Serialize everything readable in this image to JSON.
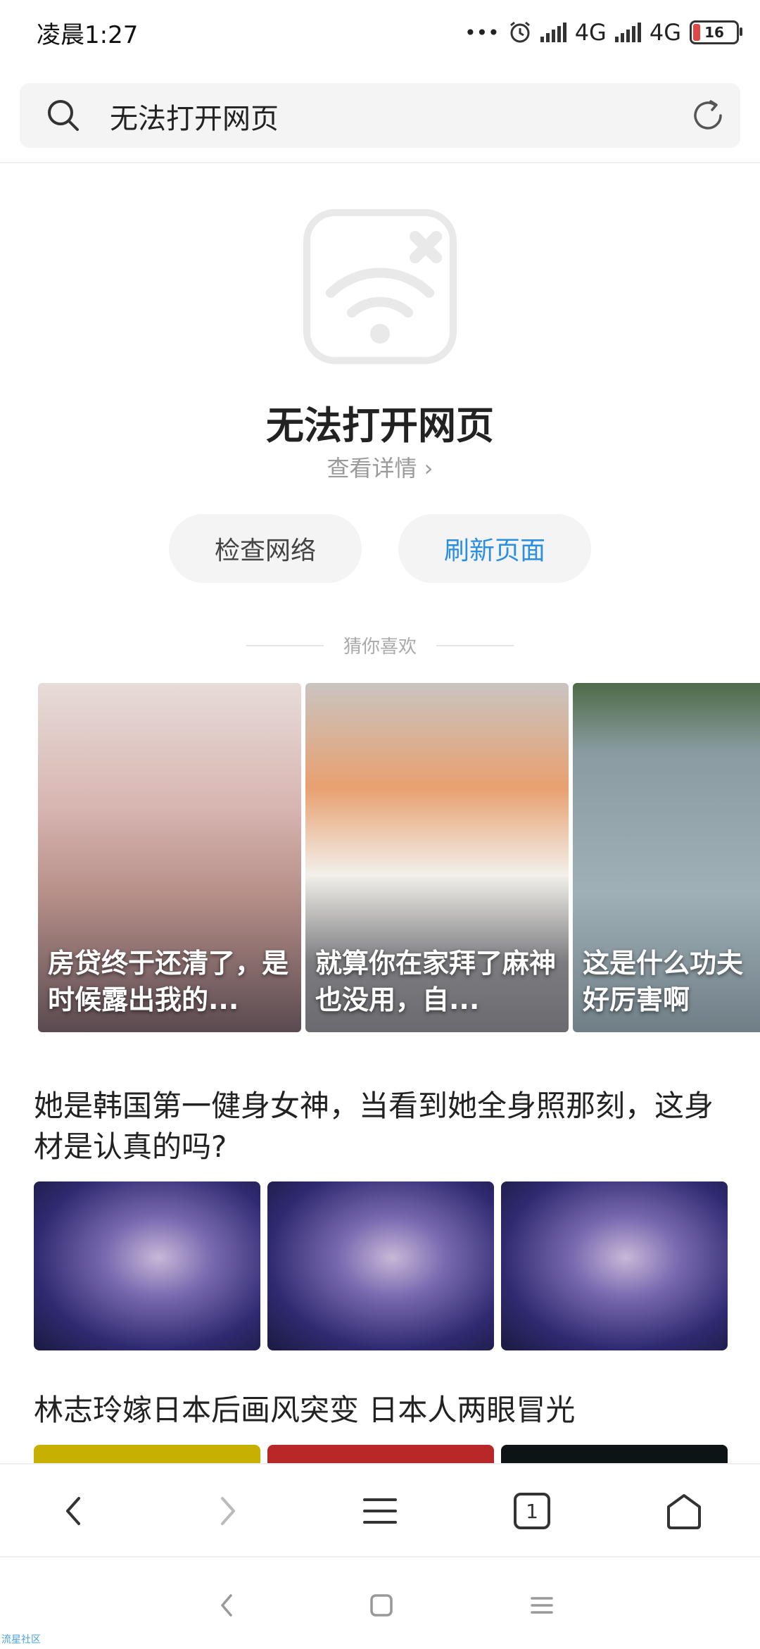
{
  "status_bar": {
    "time": "凌晨1:27",
    "dots": "•••",
    "sim1": "4G",
    "sim2": "4G",
    "battery": "16"
  },
  "search": {
    "value": "无法打开网页"
  },
  "error": {
    "title": "无法打开网页",
    "detail": "查看详情 ›",
    "check_network": "检查网络",
    "refresh_page": "刷新页面"
  },
  "guess_section": {
    "label": "猜你喜欢"
  },
  "carousel": [
    {
      "caption": "房贷终于还清了，是时候露出我的..."
    },
    {
      "caption": "就算你在家拜了麻神也没用，自..."
    },
    {
      "caption": "这是什么功夫好厉害啊"
    }
  ],
  "news": [
    {
      "title": "她是韩国第一健身女神，当看到她全身照那刻，这身材是认真的吗?"
    },
    {
      "title": "林志玲嫁日本后画风突变 日本人两眼冒光"
    }
  ],
  "toolbar": {
    "tab_count": "1"
  },
  "watermark": "流星社区"
}
